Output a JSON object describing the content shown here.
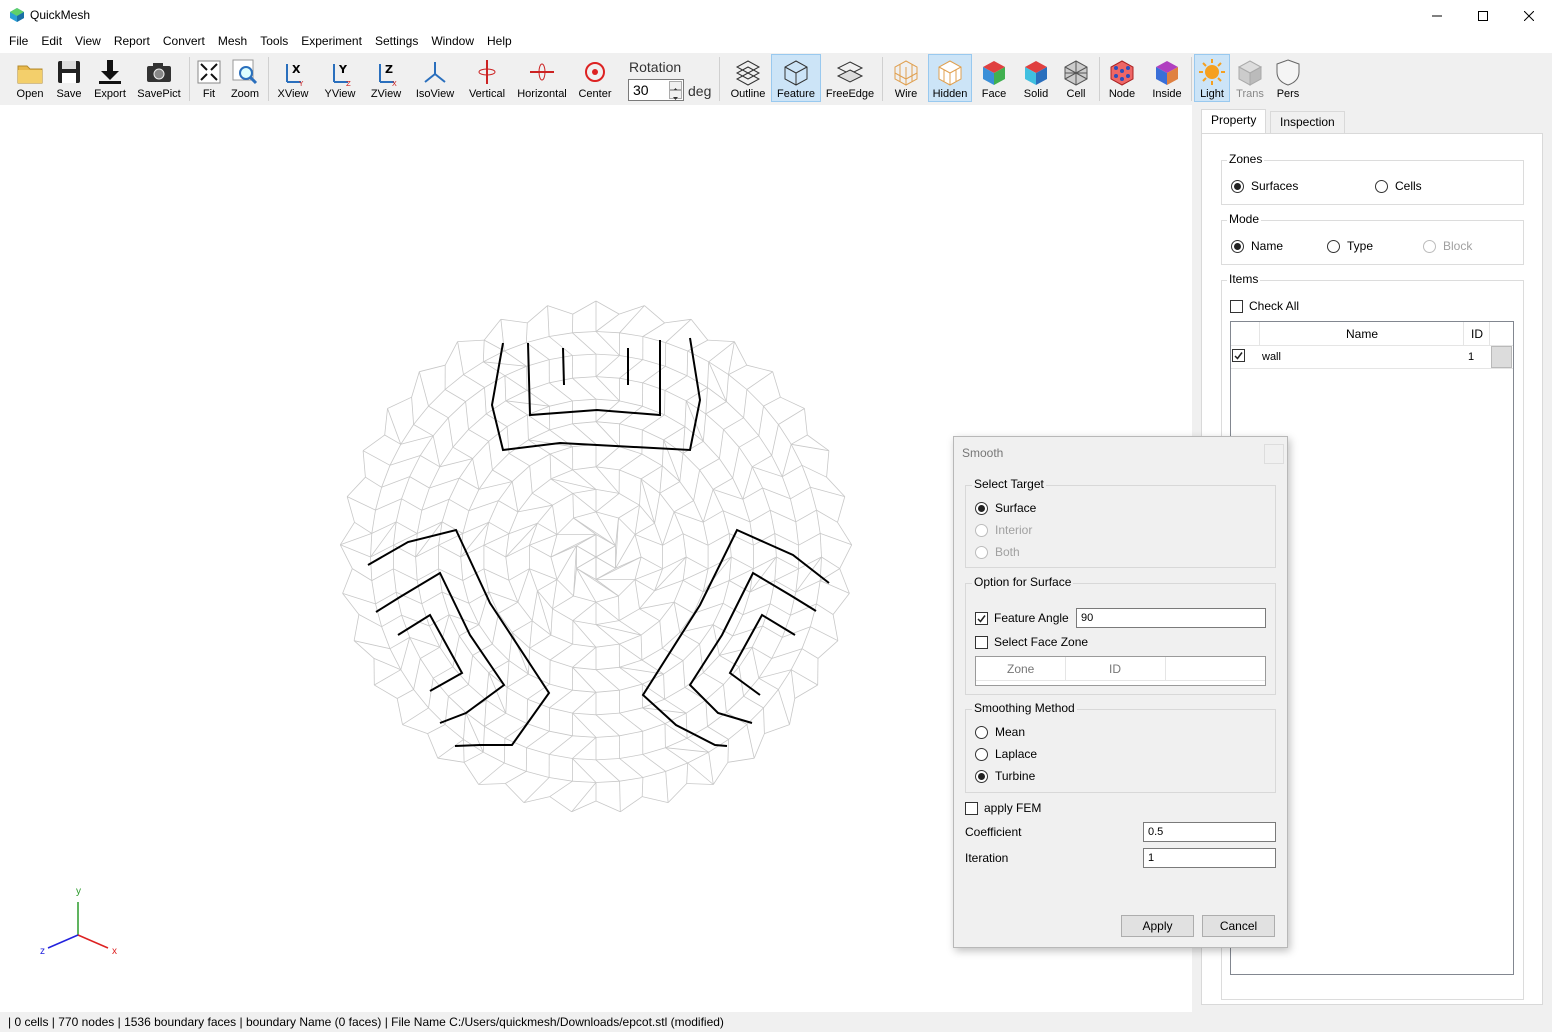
{
  "window": {
    "title": "QuickMesh"
  },
  "menu": [
    "File",
    "Edit",
    "View",
    "Report",
    "Convert",
    "Mesh",
    "Tools",
    "Experiment",
    "Settings",
    "Window",
    "Help"
  ],
  "toolbar": {
    "open": "Open",
    "save": "Save",
    "export": "Export",
    "savepict": "SavePict",
    "fit": "Fit",
    "zoom": "Zoom",
    "xview": "XView",
    "yview": "YView",
    "zview": "ZView",
    "isoview": "IsoView",
    "vertical": "Vertical",
    "horizontal": "Horizontal",
    "center": "Center",
    "rotation_label": "Rotation",
    "rotation_value": "30",
    "rotation_unit": "deg",
    "outline": "Outline",
    "feature": "Feature",
    "freeedge": "FreeEdge",
    "wire": "Wire",
    "hidden": "Hidden",
    "face": "Face",
    "solid": "Solid",
    "cell": "Cell",
    "node": "Node",
    "inside": "Inside",
    "light": "Light",
    "trans": "Trans",
    "pers": "Pers"
  },
  "axes": {
    "x": "x",
    "y": "y",
    "z": "z"
  },
  "panel": {
    "tabs": [
      "Property",
      "Inspection"
    ],
    "zones": {
      "title": "Zones",
      "surfaces": "Surfaces",
      "cells": "Cells"
    },
    "mode": {
      "title": "Mode",
      "name": "Name",
      "type": "Type",
      "block": "Block"
    },
    "items": {
      "title": "Items",
      "check_all": "Check All",
      "col_name": "Name",
      "col_id": "ID",
      "rows": [
        {
          "name": "wall",
          "id": "1"
        }
      ]
    }
  },
  "smooth": {
    "title": "Smooth",
    "select_target": {
      "title": "Select Target",
      "surface": "Surface",
      "interior": "Interior",
      "both": "Both"
    },
    "option": {
      "title": "Option for Surface",
      "feature_angle": "Feature Angle",
      "feature_angle_value": "90",
      "select_face_zone": "Select Face Zone",
      "col_zone": "Zone",
      "col_id": "ID"
    },
    "method": {
      "title": "Smoothing Method",
      "mean": "Mean",
      "laplace": "Laplace",
      "turbine": "Turbine"
    },
    "apply_fem": "apply FEM",
    "coefficient": "Coefficient",
    "coefficient_value": "0.5",
    "iteration": "Iteration",
    "iteration_value": "1",
    "apply": "Apply",
    "cancel": "Cancel"
  },
  "status": "| 0 cells | 770 nodes | 1536 boundary faces |  boundary Name  (0 faces) | File Name C:/Users/quickmesh/Downloads/epcot.stl (modified)"
}
